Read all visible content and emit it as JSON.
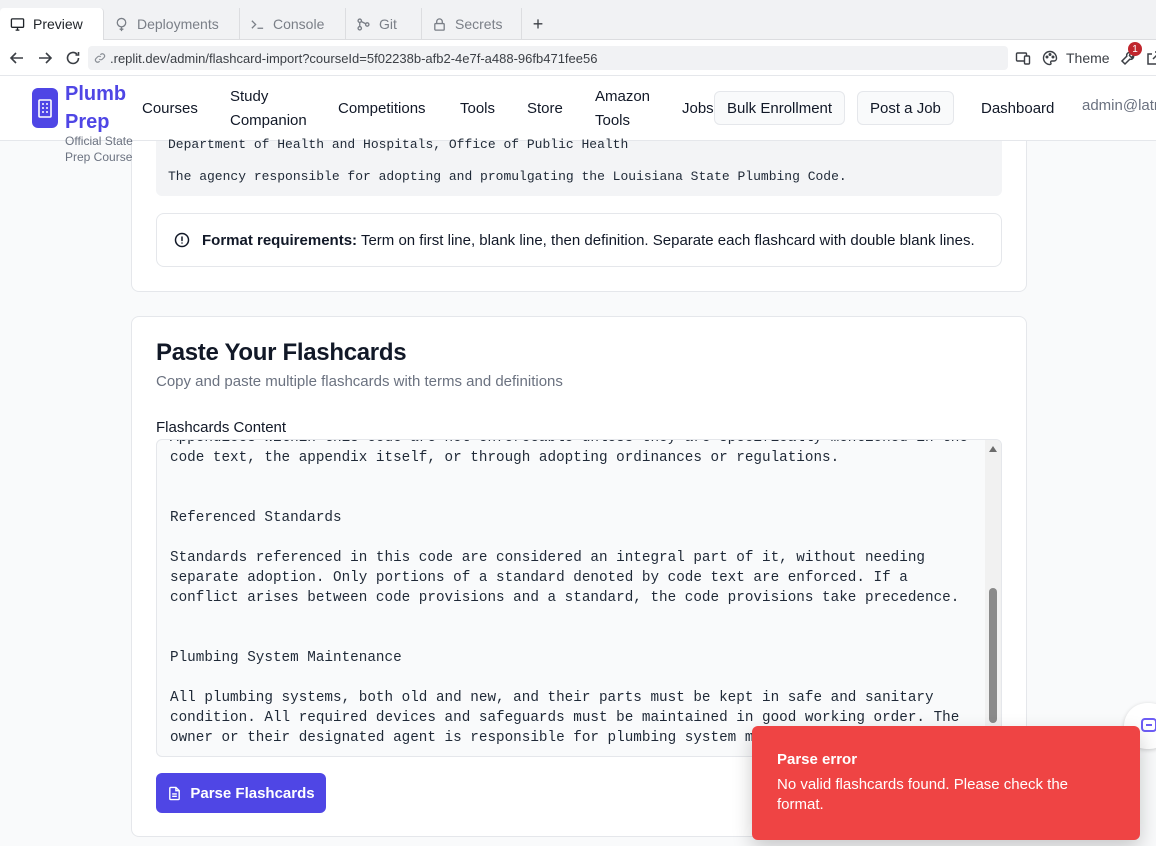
{
  "tabs": [
    {
      "label": "Preview",
      "icon": "monitor-icon",
      "active": true
    },
    {
      "label": "Deployments",
      "icon": "deployments-icon",
      "active": false
    },
    {
      "label": "Console",
      "icon": "terminal-icon",
      "active": false
    },
    {
      "label": "Git",
      "icon": "git-icon",
      "active": false
    },
    {
      "label": "Secrets",
      "icon": "lock-icon",
      "active": false
    }
  ],
  "urlbar": {
    "url": ".replit.dev/admin/flashcard-import?courseId=5f02238b-afb2-4e7f-a488-96fb471fee56",
    "theme_label": "Theme",
    "notification_count": "1"
  },
  "header": {
    "brand_name": "Plumb Prep",
    "brand_subtitle": "Official State Prep Course",
    "nav": [
      "Courses",
      "Study Companion",
      "Competitions",
      "Tools",
      "Store",
      "Amazon Tools",
      "Jobs"
    ],
    "bulk_enrollment": "Bulk Enrollment",
    "post_job": "Post a Job",
    "dashboard": "Dashboard",
    "admin_email": "admin@latr"
  },
  "example": {
    "line1": "Department of Health and Hospitals, Office of Public Health",
    "line2": "The agency responsible for adopting and promulgating the Louisiana State Plumbing Code."
  },
  "format_alert": {
    "bold": "Format requirements:",
    "text": " Term on first line, blank line, then definition. Separate each flashcard with double blank lines."
  },
  "paste_section": {
    "title": "Paste Your Flashcards",
    "description": "Copy and paste multiple flashcards with terms and definitions",
    "field_label": "Flashcards Content",
    "content": "Appendices within this code are not enforceable unless they are specifically mentioned in the code text, the appendix itself, or through adopting ordinances or regulations.\n\n\nReferenced Standards\n\nStandards referenced in this code are considered an integral part of it, without needing separate adoption. Only portions of a standard denoted by code text are enforced. If a conflict arises between code provisions and a standard, the code provisions take precedence.\n\n\nPlumbing System Maintenance\n\nAll plumbing systems, both old and new, and their parts must be kept in safe and sanitary condition. All required devices and safeguards must be maintained in good working order. The owner or their designated agent is responsible for plumbing system maintenance.",
    "parse_button": "Parse Flashcards"
  },
  "toast": {
    "title": "Parse error",
    "message": "No valid flashcards found. Please check the format."
  },
  "colors": {
    "brand": "#4f46e5",
    "toast_bg": "#ef4444"
  }
}
